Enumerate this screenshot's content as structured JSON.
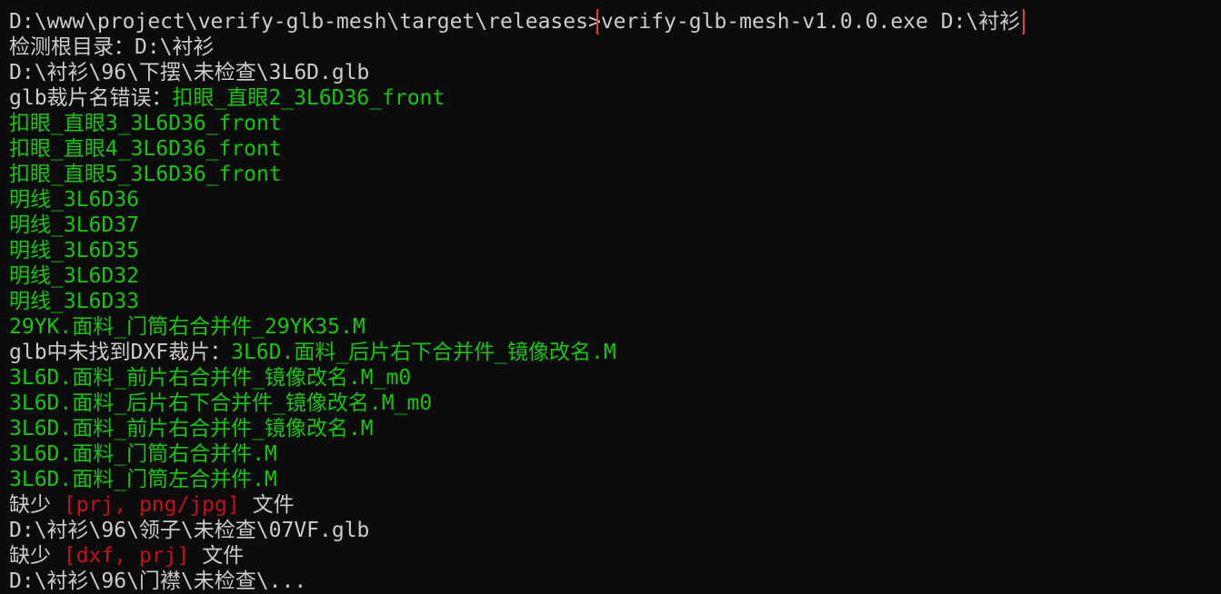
{
  "colors": {
    "background": "#0c0c0c",
    "default_text": "#cccccc",
    "green_text": "#16c60c",
    "red_text": "#c50f1f",
    "highlight_box": "#e0443a"
  },
  "command": {
    "prompt": "D:\\www\\project\\verify-glb-mesh\\target\\releases>",
    "input": "verify-glb-mesh-v1.0.0.exe D:\\衬衫"
  },
  "output": {
    "root_label": "检测根目录：",
    "root_value": "D:\\衬衫",
    "file1_path": "D:\\衬衫\\96\\下摆\\未检查\\3L6D.glb",
    "name_error_label": "glb裁片名错误：",
    "name_errors": [
      "扣眼_直眼2_3L6D36_front",
      "扣眼_直眼3_3L6D36_front",
      "扣眼_直眼4_3L6D36_front",
      "扣眼_直眼5_3L6D36_front",
      "明线_3L6D36",
      "明线_3L6D37",
      "明线_3L6D35",
      "明线_3L6D32",
      "明线_3L6D33",
      "29YK.面料_门筒右合并件_29YK35.M"
    ],
    "missing_dxf_label": "glb中未找到DXF裁片：",
    "missing_dxf": [
      "3L6D.面料_后片右下合并件_镜像改名.M",
      "3L6D.面料_前片右合并件_镜像改名.M_m0",
      "3L6D.面料_后片右下合并件_镜像改名.M_m0",
      "3L6D.面料_前片右合并件_镜像改名.M",
      "3L6D.面料_门筒右合并件.M",
      "3L6D.面料_门筒左合并件.M"
    ],
    "missing1_prefix": "缺少",
    "missing1_list": "[prj, png/jpg]",
    "missing1_suffix": "文件",
    "file2_path": "D:\\衬衫\\96\\领子\\未检查\\07VF.glb",
    "missing2_prefix": "缺少",
    "missing2_list": "[dxf, prj]",
    "missing2_suffix": "文件",
    "file3_path_partial": "D:\\衬衫\\96\\门襟\\未检查\\..."
  }
}
